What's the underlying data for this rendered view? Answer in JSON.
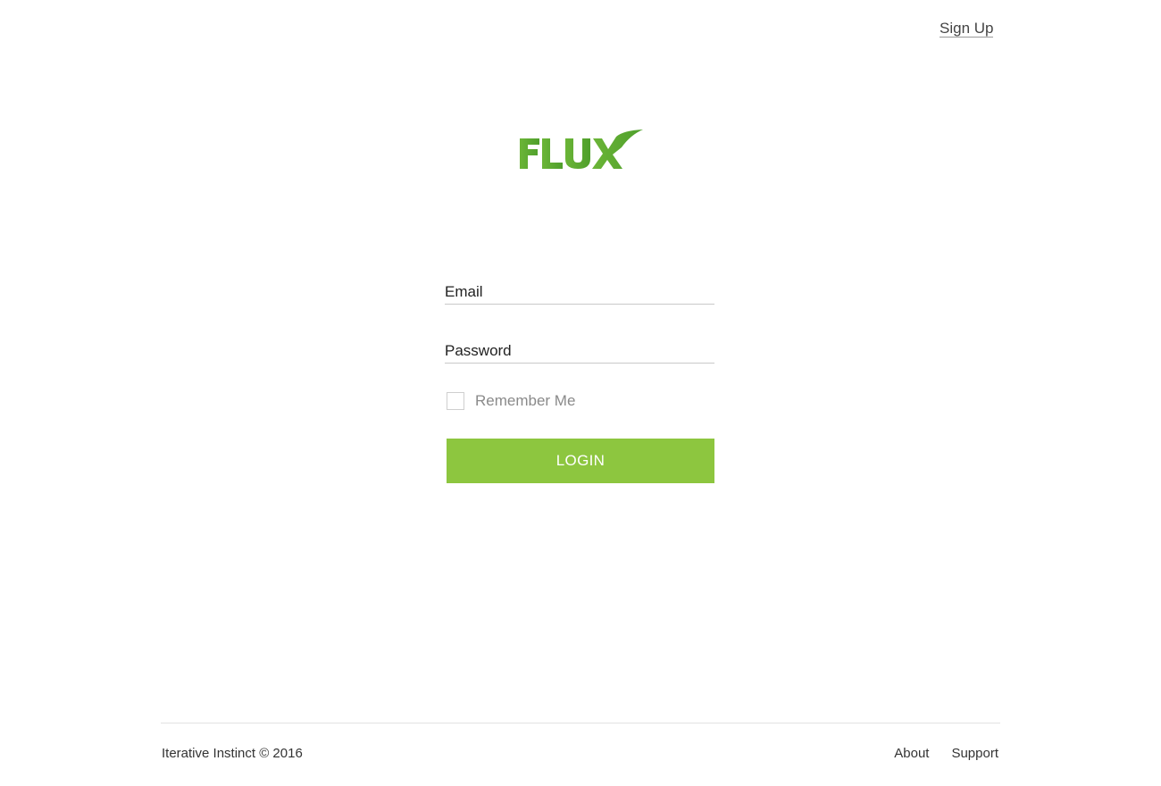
{
  "header": {
    "signup_label": "Sign Up"
  },
  "logo": {
    "text": "FLUX",
    "color": "#5aaa32"
  },
  "form": {
    "email_placeholder": "Email",
    "email_value": "",
    "password_placeholder": "Password",
    "password_value": "",
    "remember_label": "Remember Me",
    "remember_checked": false,
    "login_label": "LOGIN",
    "accent_color": "#8dc63f"
  },
  "footer": {
    "copyright": "Iterative Instinct © 2016",
    "links": [
      {
        "label": "About"
      },
      {
        "label": "Support"
      }
    ]
  }
}
